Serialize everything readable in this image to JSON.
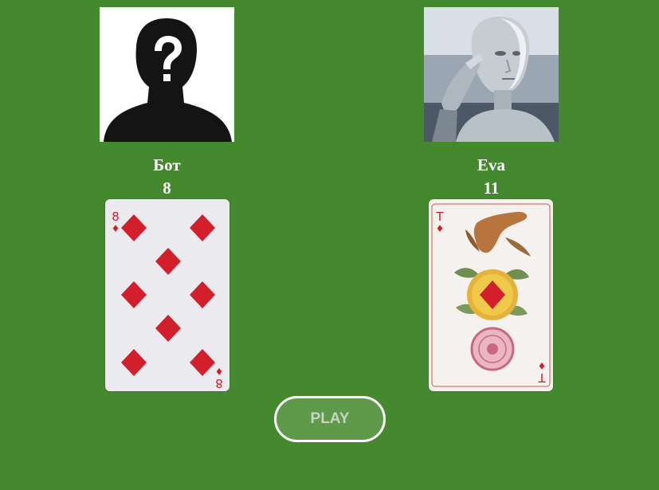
{
  "colors": {
    "table_green": "#45892f",
    "suit_red": "#d21f2b",
    "button_fill": "#5f9a4a",
    "button_border": "#ffffff"
  },
  "players": {
    "bot": {
      "name": "Бот",
      "score": "8",
      "avatar_icon": "unknown-person-silhouette-icon",
      "card": {
        "rank": "8",
        "suit": "diamonds",
        "suit_glyph": "♦"
      }
    },
    "eva": {
      "name": "Eva",
      "score": "11",
      "avatar_icon": "humanoid-robot-thinking-icon",
      "card": {
        "rank": "T",
        "suit": "diamonds",
        "suit_glyph": "♦"
      }
    }
  },
  "controls": {
    "play_label": "PLAY"
  }
}
